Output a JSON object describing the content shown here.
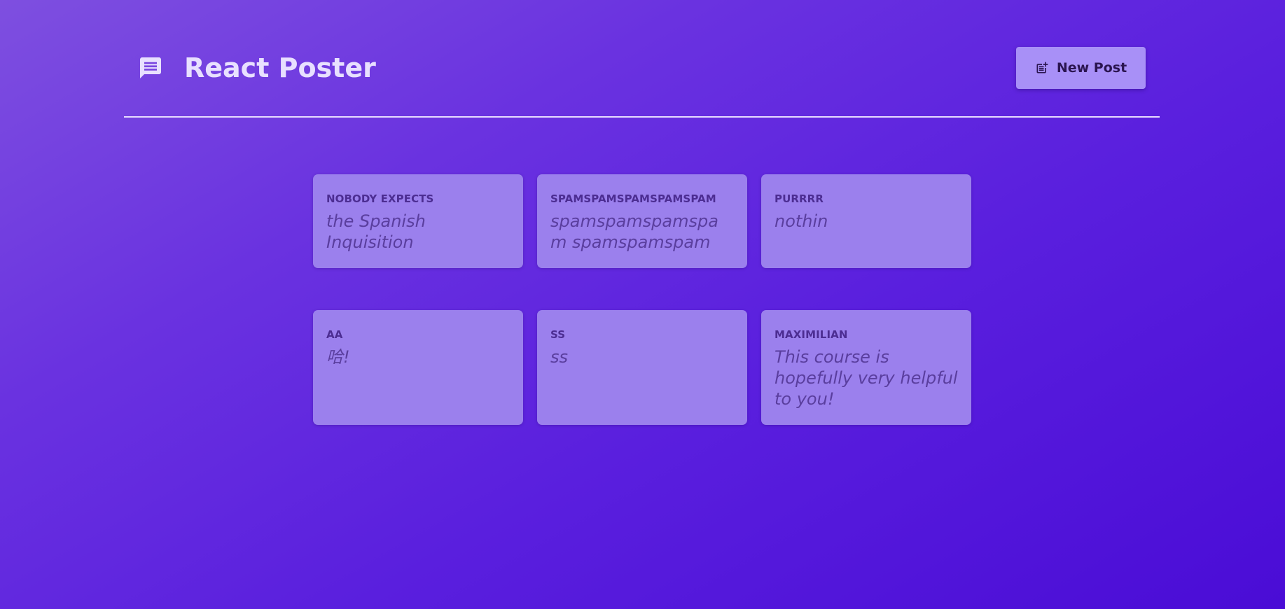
{
  "app": {
    "title": "React Poster",
    "logo_icon": "message-icon"
  },
  "header": {
    "new_post_label": "New Post",
    "new_post_icon": "post-add-icon"
  },
  "colors": {
    "accent": "#a890f7",
    "card": "#9b80ed",
    "author_text": "#4c2d92",
    "body_text": "#5a3e9e",
    "title_text": "#e8e0ff"
  },
  "posts": [
    {
      "author": "Nobody Expects",
      "body": "the Spanish Inquisition"
    },
    {
      "author": "spamspamspamspamspam",
      "body": "spamspamspamspam spamspamspam"
    },
    {
      "author": "Purrrr",
      "body": "nothin"
    },
    {
      "author": "AA",
      "body": "哈!"
    },
    {
      "author": "SS",
      "body": "ss"
    },
    {
      "author": "Maximilian",
      "body": "This course is hopefully very helpful to you!"
    }
  ]
}
